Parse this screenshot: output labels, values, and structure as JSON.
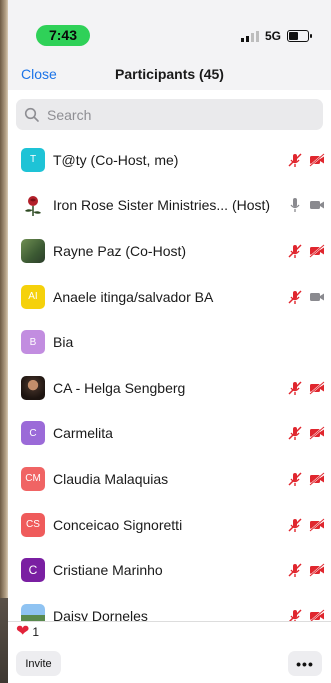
{
  "status_bar": {
    "time": "7:43",
    "network": "5G"
  },
  "header": {
    "close_label": "Close",
    "title": "Participants (45)"
  },
  "search": {
    "placeholder": "Search"
  },
  "participants": [
    {
      "initials": "T",
      "avatar_color": "#1ec3d6",
      "name": "T@ty (Co-Host, me)",
      "mic": "muted",
      "video": "off"
    },
    {
      "initials": "",
      "avatar_color": "#ffffff",
      "name": "Iron Rose Sister Ministries...  (Host)",
      "mic": "on",
      "video": "on"
    },
    {
      "initials": "",
      "avatar_color": "#4f7a3f",
      "name": "Rayne Paz (Co-Host)",
      "mic": "muted",
      "video": "off"
    },
    {
      "initials": "AI",
      "avatar_color": "#f5d10b",
      "name": "Anaele itinga/salvador BA",
      "mic": "muted",
      "video": "on"
    },
    {
      "initials": "B",
      "avatar_color": "#c28de0",
      "name": "Bia",
      "mic": "none",
      "video": "none"
    },
    {
      "initials": "",
      "avatar_color": "#3a2a22",
      "name": "CA - Helga Sengberg",
      "mic": "muted",
      "video": "off"
    },
    {
      "initials": "C",
      "avatar_color": "#9b6ad8",
      "name": "Carmelita",
      "mic": "muted",
      "video": "off"
    },
    {
      "initials": "CM",
      "avatar_color": "#f06464",
      "name": "Claudia Malaquias",
      "mic": "muted",
      "video": "off"
    },
    {
      "initials": "CS",
      "avatar_color": "#ef5b5b",
      "name": "Conceicao  Signoretti",
      "mic": "muted",
      "video": "off"
    },
    {
      "initials": "C",
      "avatar_color": "#7a1fa2",
      "name": "Cristiane Marinho",
      "mic": "muted",
      "video": "off"
    },
    {
      "initials": "",
      "avatar_color": "#8fc3f2",
      "name": "Daisy Dorneles",
      "mic": "muted",
      "video": "off"
    }
  ],
  "reaction": {
    "icon": "heart-icon",
    "count": "1"
  },
  "footer": {
    "invite_label": "Invite",
    "more_label": "•••"
  },
  "colors": {
    "accent": "#1a73e8",
    "muted_red": "#e0262e",
    "status_green": "#2fd158"
  }
}
